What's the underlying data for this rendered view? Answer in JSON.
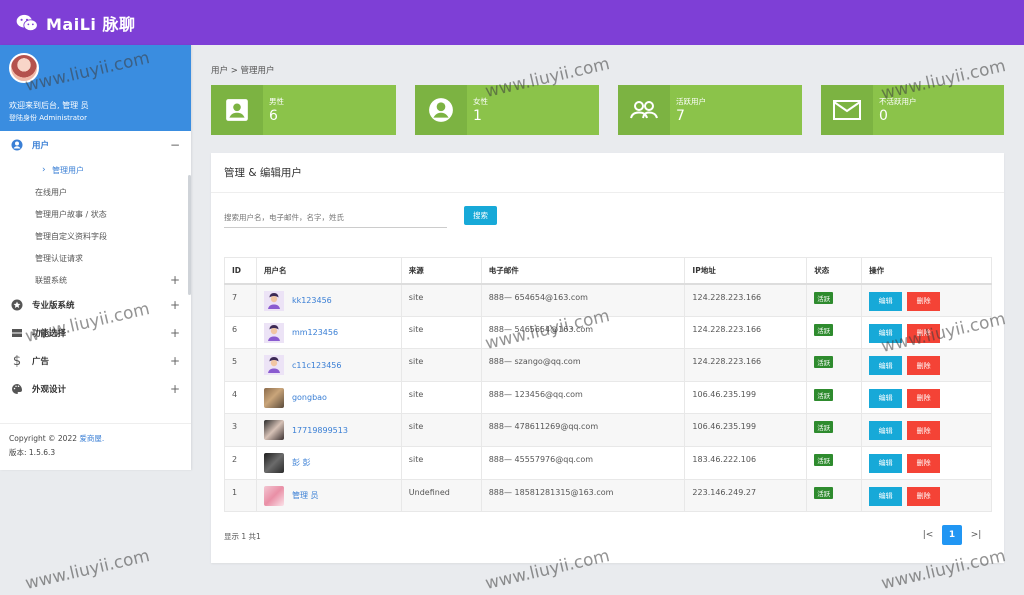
{
  "app": {
    "title": "MaiLi 脉聊"
  },
  "sidebar": {
    "welcome": "欢迎来到后台, 管理 员",
    "role": "登陆身份 Administrator",
    "menu": {
      "users": "用户",
      "users_toggle": "−",
      "sub": [
        "管理用户",
        "在线用户",
        "管理用户故事 / 状态",
        "管理自定义资料字段",
        "管理认证请求",
        "联盟系统"
      ],
      "pro": "专业版系统",
      "func": "功能选择",
      "ads": "广告",
      "design": "外观设计",
      "plus": "+"
    },
    "footer": {
      "copyright": "Copyright © 2022",
      "company": "爱商屋.",
      "version": "版本: 1.5.6.3"
    }
  },
  "breadcrumb": "用户 > 管理用户",
  "stats": [
    {
      "label": "男性",
      "value": "6",
      "icon": "portrait-icon"
    },
    {
      "label": "女性",
      "value": "1",
      "icon": "account-circle-icon"
    },
    {
      "label": "活跃用户",
      "value": "7",
      "icon": "people-icon"
    },
    {
      "label": "不活跃用户",
      "value": "0",
      "icon": "mail-icon"
    }
  ],
  "panel": {
    "title": "管理 & 编辑用户",
    "search_placeholder": "搜索用户名，电子邮件，名字，姓氏",
    "search_button": "搜索",
    "columns": [
      "ID",
      "用户名",
      "来源",
      "电子邮件",
      "IP地址",
      "状态",
      "操作"
    ],
    "rows": [
      {
        "id": "7",
        "username": "kk123456",
        "source": "site",
        "email": "888— 654654@163.com",
        "ip": "124.228.223.166",
        "status": "活跃",
        "thumb": "default"
      },
      {
        "id": "6",
        "username": "mm123456",
        "source": "site",
        "email": "888— 5465654@163.com",
        "ip": "124.228.223.166",
        "status": "活跃",
        "thumb": "default"
      },
      {
        "id": "5",
        "username": "c11c123456",
        "source": "site",
        "email": "888— szango@qq.com",
        "ip": "124.228.223.166",
        "status": "活跃",
        "thumb": "default"
      },
      {
        "id": "4",
        "username": "gongbao",
        "source": "site",
        "email": "888— 123456@qq.com",
        "ip": "106.46.235.199",
        "status": "活跃",
        "thumb": "photo-food"
      },
      {
        "id": "3",
        "username": "17719899513",
        "source": "site",
        "email": "888— 478611269@qq.com",
        "ip": "106.46.235.199",
        "status": "活跃",
        "thumb": "photo-girl"
      },
      {
        "id": "2",
        "username": "彭 彭",
        "source": "site",
        "email": "888— 45557976@qq.com",
        "ip": "183.46.222.106",
        "status": "活跃",
        "thumb": "photo-dark"
      },
      {
        "id": "1",
        "username": "管理 员",
        "source": "Undefined",
        "email": "888— 18581281315@163.com",
        "ip": "223.146.249.27",
        "status": "活跃",
        "thumb": "photo-pink"
      }
    ],
    "edit_label": "编辑",
    "delete_label": "删除",
    "showing": "显示 1 共1",
    "pagination": {
      "first": "|<",
      "current": "1",
      "last": ">|"
    }
  },
  "watermark": "www.liuyii.com",
  "colors": {
    "topbar": "#7e3fd6",
    "profile": "#3a8de0",
    "stat": "#8bc34a",
    "stat_icon": "#7cb342",
    "edit": "#17a9d8",
    "delete": "#f44336",
    "active_badge": "#2e8b2e"
  }
}
